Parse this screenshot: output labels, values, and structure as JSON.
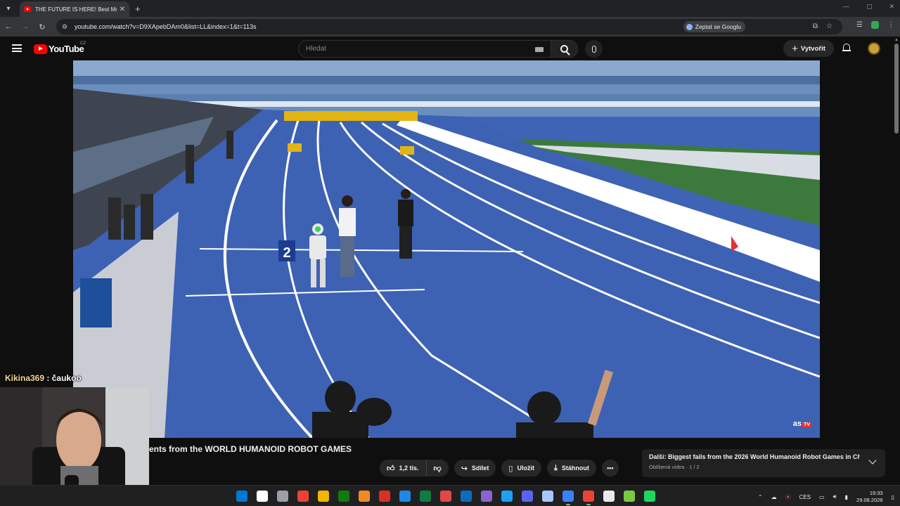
{
  "browser": {
    "tab_title": "THE FUTURE IS HERE! Best Mo",
    "url": "youtube.com/watch?v=D9XApebDAm0&list=LL&index=1&t=113s",
    "ask_google": "Zeptat se Googlu"
  },
  "youtube": {
    "logo_text": "YouTube",
    "country_code": "CZ",
    "search_placeholder": "Hledat",
    "create_label": "Vytvořit",
    "watermark": "as",
    "watermark_badge": "TV"
  },
  "video": {
    "title_visible": "ents from the WORLD HUMANOID ROBOT GAMES",
    "lane_number": "2",
    "like_count": "1,2 tis.",
    "share_label": "Sdílet",
    "save_label": "Uložit",
    "download_label": "Stáhnout"
  },
  "next_up": {
    "title": "Další: Biggest fails from the 2026 World Humanoid Robot Games in Ch...",
    "subtitle": "Oblíbená videa · 1 / 2"
  },
  "chat": {
    "user": "Kikina369",
    "message": ": čaukoo"
  },
  "taskbar": {
    "language": "CES",
    "time": "19:33",
    "date": "29.08.2026",
    "icon_colors": [
      "#0078d4",
      "#ffffff",
      "#9aa0a6",
      "#ea4335",
      "#f4b400",
      "#0f7b0f",
      "#f08a24",
      "#d93025",
      "#1e88e5",
      "#107c41",
      "#e04848",
      "#0f6cbd",
      "#8a63d2",
      "#1da1f2",
      "#5865f2",
      "#a8c7fa",
      "#3b82f6",
      "#ea4335",
      "#e8eaed",
      "#7ac943",
      "#1ed760"
    ]
  }
}
